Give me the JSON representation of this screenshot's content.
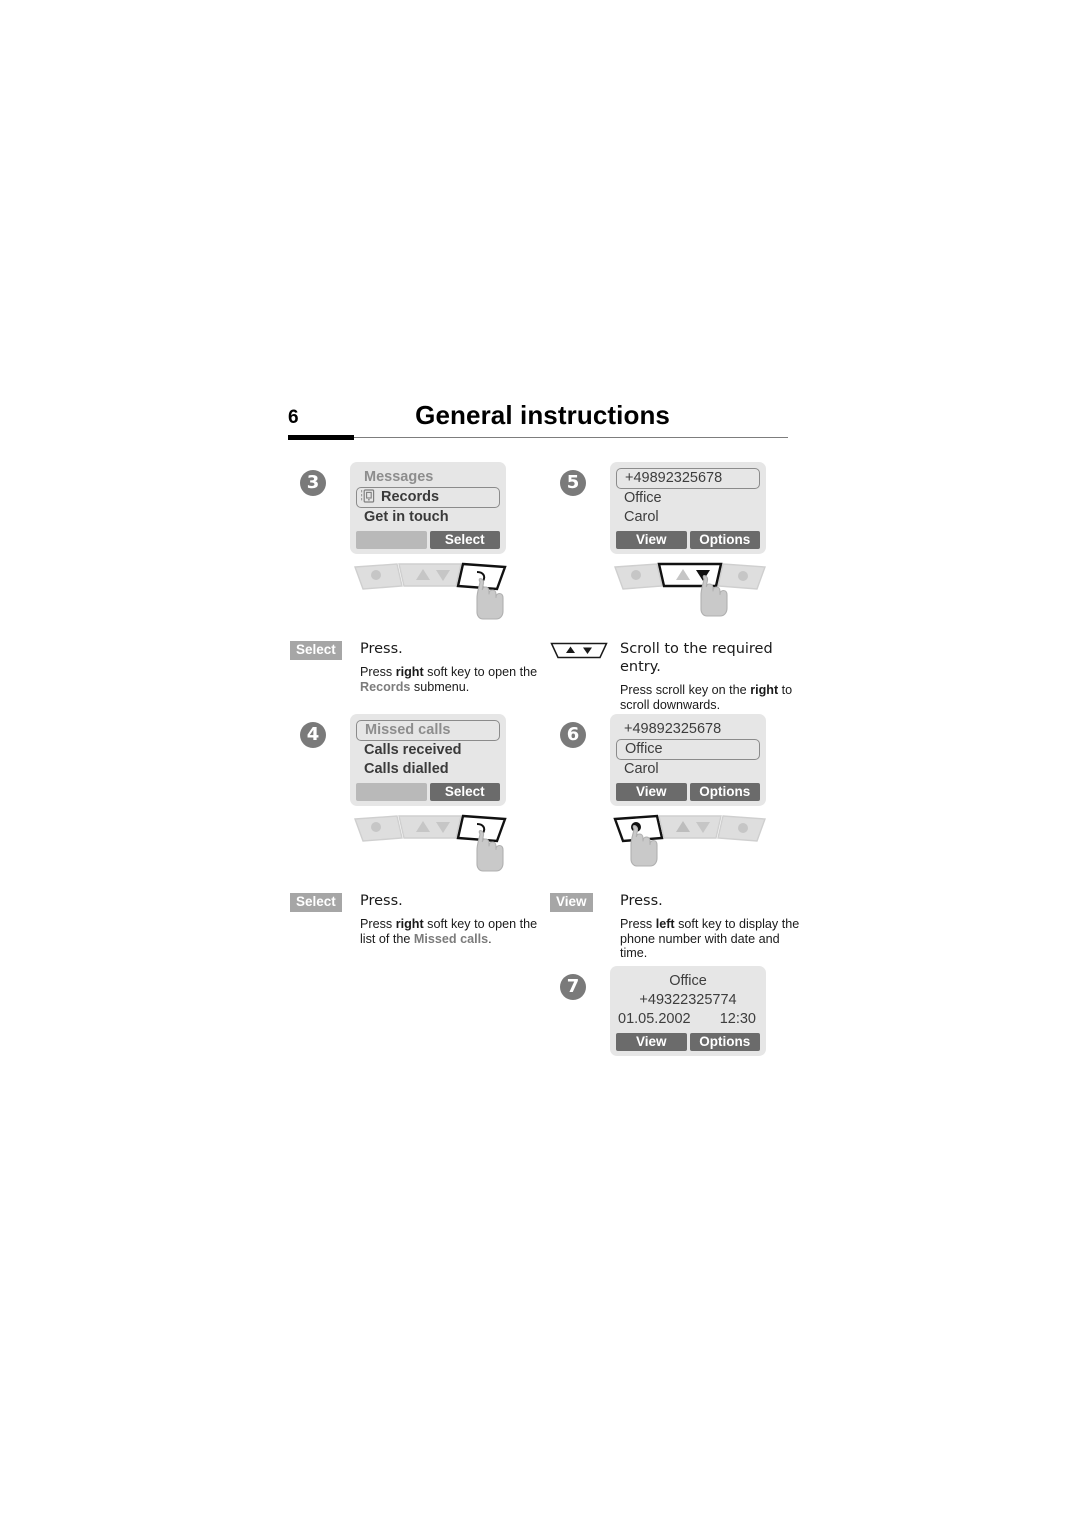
{
  "header": {
    "page_number": "6",
    "title": "General instructions"
  },
  "steps": [
    {
      "number": "3",
      "column": "left",
      "screen": {
        "rows": [
          {
            "text": "Messages",
            "style": "dim",
            "selected": false,
            "icon": null
          },
          {
            "text": "Records",
            "style": "dark",
            "selected": true,
            "icon": "records-icon"
          },
          {
            "text": "Get in touch",
            "style": "dark",
            "selected": false,
            "icon": null
          }
        ],
        "softkeys": [
          {
            "label": "",
            "empty": true
          },
          {
            "label": "Select",
            "empty": false
          }
        ]
      },
      "keypad": "right-softkey-pressed",
      "caption": {
        "key_label": "Select",
        "key_type": "softkey",
        "lead": "Press.",
        "desc_parts": [
          {
            "text": "Press ",
            "style": "normal"
          },
          {
            "text": "right",
            "style": "bold"
          },
          {
            "text": " soft key to open the ",
            "style": "normal"
          },
          {
            "text": "Records",
            "style": "gray"
          },
          {
            "text": " submenu.",
            "style": "normal"
          }
        ]
      }
    },
    {
      "number": "4",
      "column": "left",
      "screen": {
        "rows": [
          {
            "text": "Missed calls",
            "style": "dim",
            "selected": true,
            "icon": null
          },
          {
            "text": "Calls received",
            "style": "dark",
            "selected": false,
            "icon": null
          },
          {
            "text": "Calls dialled",
            "style": "dark",
            "selected": false,
            "icon": null
          }
        ],
        "softkeys": [
          {
            "label": "",
            "empty": true
          },
          {
            "label": "Select",
            "empty": false
          }
        ]
      },
      "keypad": "right-softkey-pressed",
      "caption": {
        "key_label": "Select",
        "key_type": "softkey",
        "lead": "Press.",
        "desc_parts": [
          {
            "text": "Press ",
            "style": "normal"
          },
          {
            "text": "right",
            "style": "bold"
          },
          {
            "text": " soft key to open the list of the ",
            "style": "normal"
          },
          {
            "text": "Missed calls",
            "style": "gray"
          },
          {
            "text": ".",
            "style": "normal"
          }
        ]
      }
    },
    {
      "number": "5",
      "column": "right",
      "screen": {
        "rows": [
          {
            "text": "+49892325678",
            "style": "plain",
            "selected": true,
            "icon": null
          },
          {
            "text": "Office",
            "style": "plain",
            "selected": false,
            "icon": null
          },
          {
            "text": "Carol",
            "style": "plain",
            "selected": false,
            "icon": null
          }
        ],
        "softkeys": [
          {
            "label": "View",
            "empty": false
          },
          {
            "label": "Options",
            "empty": false
          }
        ]
      },
      "keypad": "scroll-down-pressed",
      "caption": {
        "key_label": "",
        "key_type": "scroll-key-icon",
        "lead": "Scroll to the required entry.",
        "desc_parts": [
          {
            "text": "Press scroll key on the ",
            "style": "normal"
          },
          {
            "text": "right",
            "style": "bold"
          },
          {
            "text": " to scroll downwards.",
            "style": "normal"
          }
        ]
      }
    },
    {
      "number": "6",
      "column": "right",
      "screen": {
        "rows": [
          {
            "text": "+49892325678",
            "style": "plain",
            "selected": false,
            "icon": null
          },
          {
            "text": "Office",
            "style": "plain",
            "selected": true,
            "icon": null
          },
          {
            "text": "Carol",
            "style": "plain",
            "selected": false,
            "icon": null
          }
        ],
        "softkeys": [
          {
            "label": "View",
            "empty": false
          },
          {
            "label": "Options",
            "empty": false
          }
        ]
      },
      "keypad": "left-softkey-pressed",
      "caption": {
        "key_label": "View",
        "key_type": "softkey",
        "lead": "Press.",
        "desc_parts": [
          {
            "text": "Press ",
            "style": "normal"
          },
          {
            "text": "left",
            "style": "bold"
          },
          {
            "text": " soft key to display the phone number with date and time.",
            "style": "normal"
          }
        ]
      }
    },
    {
      "number": "7",
      "column": "right",
      "screen": {
        "rows": [
          {
            "text": "Office",
            "style": "plain",
            "selected": false,
            "icon": null,
            "align": "center"
          },
          {
            "text": "+49322325774",
            "style": "plain",
            "selected": false,
            "icon": null,
            "align": "center"
          },
          {
            "text": "01.05.2002",
            "text_right": "12:30",
            "style": "plain",
            "selected": false,
            "icon": null,
            "align": "split"
          }
        ],
        "softkeys": [
          {
            "label": "View",
            "empty": false
          },
          {
            "label": "Options",
            "empty": false
          }
        ]
      },
      "keypad": null,
      "caption": null
    }
  ],
  "colors": {
    "screen_background": "#e6e6e6",
    "softkey_active": "#6b6b6b",
    "softkey_inactive": "#b9b9b9",
    "badge": "#7a7a7a",
    "caption_key_badge": "#a6a6a6",
    "dim_text": "#8d8d8d",
    "dark_text": "#3a3a3a"
  }
}
